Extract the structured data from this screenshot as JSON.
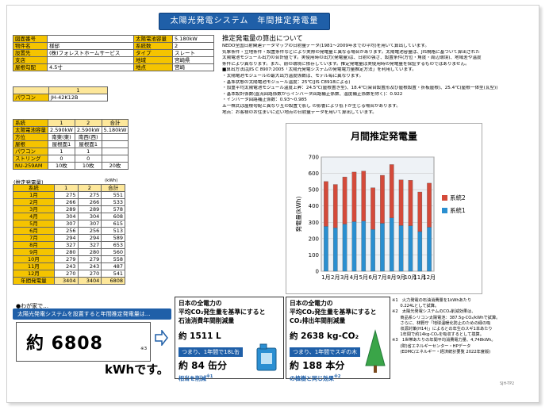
{
  "title": "太陽光発電システム　年間推定発電量",
  "info_rows": [
    [
      "図面番号",
      "",
      "太陽電池容量",
      "5.180kW"
    ],
    [
      "物件名",
      "様邸",
      "系統数",
      "2"
    ],
    [
      "設置先",
      "(株)フォレストホームサービス",
      "タイプ",
      "スレート"
    ],
    [
      "支店",
      "",
      "地域",
      "宮崎県"
    ],
    [
      "屋根勾配",
      "4.5寸",
      "地点",
      "宮崎"
    ]
  ],
  "pc": {
    "head": "1",
    "label": "パワコン",
    "value": "JH-42K12B"
  },
  "sys": {
    "headers": [
      "",
      "1",
      "2",
      "合計"
    ],
    "rows": [
      [
        "系統",
        "1",
        "2",
        "合計"
      ],
      [
        "太陽電池容量",
        "2.590kW",
        "2.590kW",
        "5.180kW"
      ],
      [
        "方位",
        "南東(東)",
        "南西(西)",
        ""
      ],
      [
        "屋根",
        "屋根面1",
        "屋根面1",
        ""
      ],
      [
        "パワコン",
        "1",
        "1",
        ""
      ],
      [
        "ストリング",
        "0",
        "0",
        ""
      ],
      [
        "NU-259AM",
        "10枚",
        "10枚",
        "20枚"
      ]
    ]
  },
  "monthly": {
    "caption": "(推定発電量)",
    "unit": "(kWh)",
    "headers": [
      "系統",
      "1",
      "2",
      "合計"
    ],
    "rows": [
      [
        "1月",
        "275",
        "275",
        "551"
      ],
      [
        "2月",
        "266",
        "266",
        "533"
      ],
      [
        "3月",
        "289",
        "289",
        "578"
      ],
      [
        "4月",
        "304",
        "304",
        "608"
      ],
      [
        "5月",
        "307",
        "307",
        "615"
      ],
      [
        "6月",
        "256",
        "256",
        "513"
      ],
      [
        "7月",
        "294",
        "294",
        "589"
      ],
      [
        "8月",
        "327",
        "327",
        "653"
      ],
      [
        "9月",
        "280",
        "280",
        "560"
      ],
      [
        "10月",
        "279",
        "279",
        "558"
      ],
      [
        "11月",
        "243",
        "243",
        "487"
      ],
      [
        "12月",
        "270",
        "270",
        "541"
      ]
    ],
    "total": [
      "年間発電量",
      "3404",
      "3404",
      "6808"
    ]
  },
  "calc": {
    "heading": "推定発電量の算出について",
    "lines": [
      "NEDO全国日射関連データマップの日射量データ(1981〜2009年までの平均)を用いて算出しています。",
      "気象条件・立地条件・設置条件などにより実際の発電量と異なる場合があります。太陽電池容量は、JIS規格に基づいて算出された",
      "太陽電池モジュール出力の合計値です。実使用時の出力(発電量)は、日射の強さ、設置条件(方位・角度・周辺環境)、地域差や温度",
      "条件により異なります。また、前の環境に依存しています。推定発電量は実使用時の発電量を保証するものではありません。",
      "■算出方法はJIS C 8907:2005「太陽光発電システムの発電電力量推定方法」を利用しています。",
      "・太陽電池モジュールの最大出力温度係数は、モデル毎に異なります。",
      "・基準状態の太陽電池モジュール温度：25℃(JIS C8918による)",
      "・加重平均太陽電池モジュール温度上昇：24.5℃(屋根置き型)、18.4℃(架台設置形及び屋根設置・折板屋根)、25.4℃(屋根一体型(瓦型))",
      "・基本設計係数(直流回路係数からインバータ回路補正係数、温度補正係数を除く)：0.922",
      "・インバータ回路補正係数：0.93〜0.985",
      "五一株式は屋根勾配と異なり互の設置で影し の影響により低下が生じる場合があります。",
      "地点：お客様のお住まいに近い地点の日射量データを用いて算出しています。"
    ]
  },
  "chart_data": {
    "type": "bar",
    "title": "月間推定発電量",
    "ylabel": "発電量(kWh)",
    "xlabel": "",
    "ylim": [
      0,
      700
    ],
    "yticks": [
      0,
      100,
      200,
      300,
      400,
      500,
      600,
      700
    ],
    "categories": [
      "1月",
      "2月",
      "3月",
      "4月",
      "5月",
      "6月",
      "7月",
      "8月",
      "9月",
      "10月",
      "11月",
      "12月"
    ],
    "stacked": true,
    "legend": "right",
    "series": [
      {
        "name": "系統1",
        "values": [
          275,
          266,
          289,
          304,
          307,
          256,
          294,
          327,
          280,
          279,
          243,
          270
        ],
        "color": "#2a8fd0"
      },
      {
        "name": "系統2",
        "values": [
          275,
          266,
          289,
          304,
          307,
          256,
          294,
          327,
          280,
          279,
          243,
          270
        ],
        "color": "#d44a3a"
      }
    ]
  },
  "result": {
    "bullet": "●わが家で…",
    "banner": "太陽光発電システムを設置すると年間推定発電量は…",
    "approx": "約 6808",
    "note_mark": "※3",
    "unit": "kWhです。"
  },
  "oil": {
    "head1": "日本の全電力の",
    "head2": "平均CO₂発生量を基準にすると",
    "head3": "石油消費年間削減量",
    "amount": "約 1511 L",
    "sub": "つまり、1年間で18L缶",
    "count": "約 84 缶分",
    "link": "相当を削減",
    "link_note": "※1"
  },
  "co2": {
    "head1": "日本の全電力の",
    "head2": "平均CO₂発生量を基準にすると",
    "head3": "CO₂排出年間削減量",
    "amount": "約 2638 kg-CO₂",
    "sub": "つまり、1年間でスギの木",
    "count": "約 188 本分",
    "link": "の植樹と同じ効果",
    "link_note": "※2"
  },
  "notes": [
    "※1　火力発電の石油消費量を1kWhあたり",
    "　　0.224Lとして試算。",
    "※2　太陽光発電システムのCO₂削減効果は、",
    "　　商品系シリコン太陽電池：387.5g-CO₂/kWhで試算。",
    "　　さらに、林野庁「地球温暖化防止のための緑の吸",
    "　　収源対策(H14)」によるとの年生のスギ1本あたり",
    "　　1年間で約14kg-CO₂を吸収するとして換算。",
    "※3　1世帯あたりの年間平均消費電力量、4,748kWh。",
    "　　(財)省エネルギーセンター・HPデータ",
    "　　(EDMC/エネルギー・経済統計要覧 2022年度版)"
  ],
  "footer": "SJH-TP2"
}
